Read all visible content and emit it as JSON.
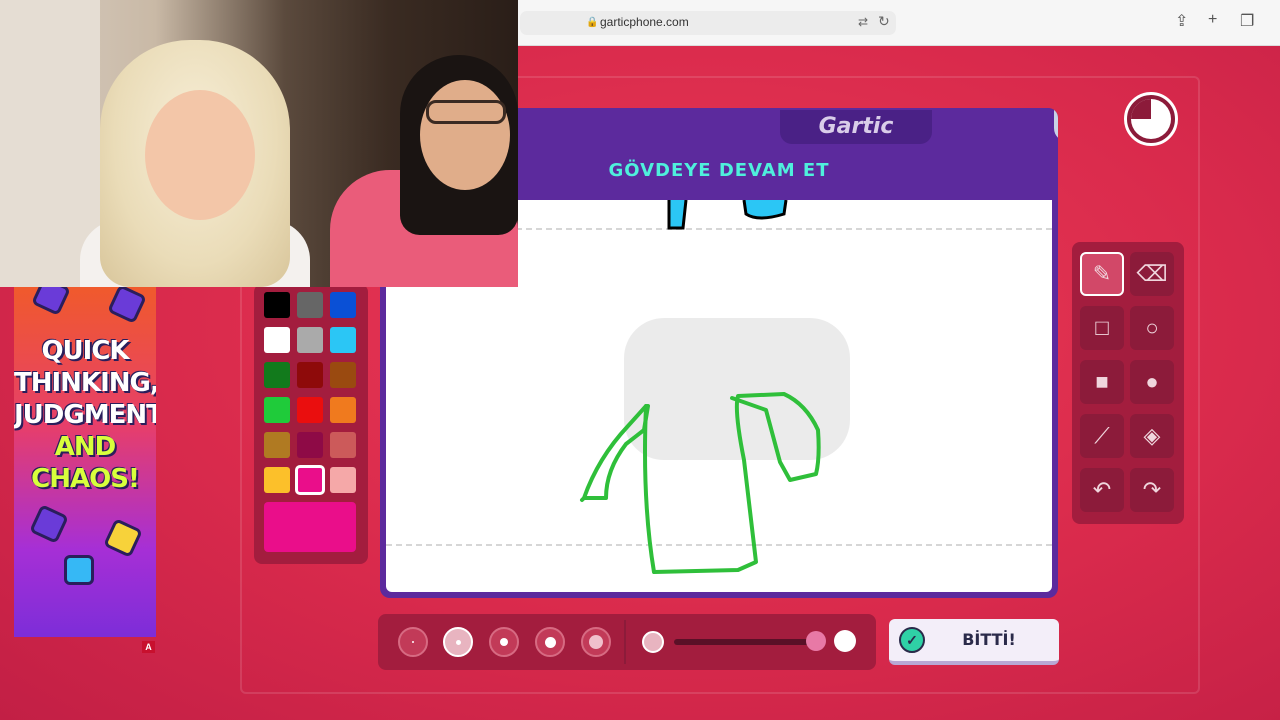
{
  "browser": {
    "url": "garticphone.com"
  },
  "ad": {
    "line1": "QUICK",
    "line2": "THINKING,",
    "line3": "JUDGMENT",
    "line4": "AND",
    "line5": "CHAOS!",
    "badge": "A"
  },
  "game": {
    "logo": "Gartic",
    "prompt": "GÖVDEYE DEVAM ET",
    "done_label": "BİTTİ!"
  },
  "palette": {
    "colors": [
      "#000000",
      "#666666",
      "#0a50d6",
      "#ffffff",
      "#aaaaaa",
      "#2bc6f5",
      "#127a1c",
      "#8e0a0a",
      "#9a4a10",
      "#1fcb3a",
      "#ea0e0e",
      "#f07a1e",
      "#b07a22",
      "#8e0a46",
      "#cc5a5a",
      "#fcc02a",
      "#ea0e8a",
      "#f5a8a8"
    ],
    "selected_index": 16,
    "current_color": "#ea0e8a"
  },
  "tools": {
    "active": "pencil"
  },
  "brush": {
    "selected_size_index": 1
  },
  "theme": {
    "background": "#d92a4c",
    "board": "#5c2a9d",
    "prompt_color": "#4ff0dc",
    "stroke": "#2fbf3a"
  }
}
